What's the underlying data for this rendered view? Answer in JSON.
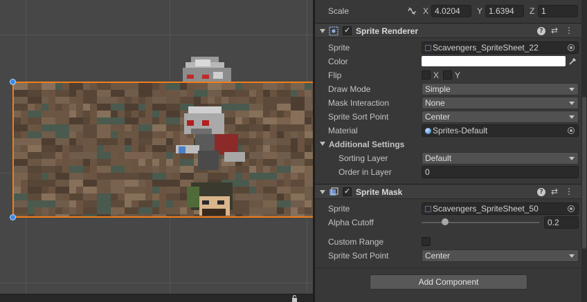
{
  "scale": {
    "label": "Scale",
    "x_label": "X",
    "x_value": "4.0204",
    "y_label": "Y",
    "y_value": "1.6394",
    "z_label": "Z",
    "z_value": "1"
  },
  "sprite_renderer": {
    "title": "Sprite Renderer",
    "enabled": true,
    "fields": {
      "sprite": {
        "label": "Sprite",
        "value": "Scavengers_SpriteSheet_22"
      },
      "color": {
        "label": "Color",
        "value": "#ffffff"
      },
      "flip": {
        "label": "Flip",
        "x_label": "X",
        "y_label": "Y",
        "x": false,
        "y": false
      },
      "draw_mode": {
        "label": "Draw Mode",
        "value": "Simple"
      },
      "mask_interaction": {
        "label": "Mask Interaction",
        "value": "None"
      },
      "sort_point": {
        "label": "Sprite Sort Point",
        "value": "Center"
      },
      "material": {
        "label": "Material",
        "value": "Sprites-Default"
      }
    },
    "additional_settings": {
      "label": "Additional Settings",
      "sorting_layer": {
        "label": "Sorting Layer",
        "value": "Default"
      },
      "order_in_layer": {
        "label": "Order in Layer",
        "value": "0"
      }
    }
  },
  "sprite_mask": {
    "title": "Sprite Mask",
    "enabled": true,
    "fields": {
      "sprite": {
        "label": "Sprite",
        "value": "Scavengers_SpriteSheet_50"
      },
      "alpha_cutoff": {
        "label": "Alpha Cutoff",
        "value": "0.2",
        "fraction": 0.2
      },
      "custom_range": {
        "label": "Custom Range",
        "checked": false
      },
      "sort_point": {
        "label": "Sprite Sort Point",
        "value": "Center"
      }
    }
  },
  "add_component_label": "Add Component",
  "icons": {
    "help": "help-icon",
    "presets": "presets-icon",
    "menu": "kebab-menu-icon",
    "eyedropper": "eyedropper-icon",
    "link": "unlink-icon",
    "lock": "lock-icon"
  },
  "colors": {
    "selection_outline": "#f07f1a",
    "handle": "#3e8ae6",
    "panel_bg": "#383838"
  }
}
